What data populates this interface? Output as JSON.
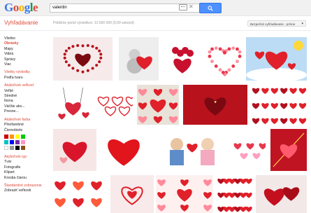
{
  "logo": {
    "text": "Google",
    "letters": [
      [
        "G",
        "#3b78e7"
      ],
      [
        "o",
        "#dd4b39"
      ],
      [
        "o",
        "#f4b400"
      ],
      [
        "g",
        "#3b78e7"
      ],
      [
        "l",
        "#0f9d58"
      ],
      [
        "e",
        "#dd4b39"
      ]
    ]
  },
  "search": {
    "query": "valentin"
  },
  "header": {
    "section_title": "Vyhľadávanie",
    "stats": "Približne počet výsledkov: 31 600 000 (0,09 sekúnd)",
    "safe_search": "Bezpečné vyhľadávanie - prísne"
  },
  "sidebar": {
    "groups": [
      [
        {
          "label": "Všetko",
          "type": "link"
        },
        {
          "label": "Obrázky",
          "type": "active"
        },
        {
          "label": "Mapy",
          "type": "link"
        },
        {
          "label": "Videá",
          "type": "link"
        },
        {
          "label": "Správy",
          "type": "link"
        },
        {
          "label": "Viac",
          "type": "link"
        }
      ],
      [
        {
          "label": "Všetky výsledky",
          "type": "head"
        },
        {
          "label": "Podľa tvaru",
          "type": "link"
        }
      ],
      [
        {
          "label": "Akákoľvek veľkosť",
          "type": "head"
        },
        {
          "label": "Veľké",
          "type": "link"
        },
        {
          "label": "Stredné",
          "type": "link"
        },
        {
          "label": "Ikona",
          "type": "link"
        },
        {
          "label": "Väčšie ako...",
          "type": "link"
        },
        {
          "label": "Presne...",
          "type": "link"
        }
      ],
      [
        {
          "label": "Akákoľvek farba",
          "type": "head"
        },
        {
          "label": "Plnofarebné",
          "type": "link"
        },
        {
          "label": "Čiernobiele",
          "type": "link"
        }
      ],
      [
        {
          "label": "Akýkoľvek typ",
          "type": "head"
        },
        {
          "label": "Tvár",
          "type": "link"
        },
        {
          "label": "Fotografie",
          "type": "link"
        },
        {
          "label": "Klipart",
          "type": "link"
        },
        {
          "label": "Kresba čiarou",
          "type": "link"
        }
      ],
      [
        {
          "label": "Štandardné zobrazenie",
          "type": "head"
        },
        {
          "label": "Zobraziť veľkosti",
          "type": "link"
        }
      ]
    ],
    "swatch_colors": [
      "#cc0000",
      "#fb940b",
      "#ffff00",
      "#00cc00",
      "#03c0c6",
      "#0000ff",
      "#762ca7",
      "#ff98bf",
      "#ffffff",
      "#999999",
      "#000000",
      "#885418"
    ]
  },
  "results": [
    {
      "bg": "#f6eaea",
      "style": "heart-beads",
      "color": "#b5121b"
    },
    {
      "bg": "#eeeeee",
      "style": "bear",
      "color": "#e0202a"
    },
    {
      "bg": "#ffffff",
      "style": "roses",
      "color": "#c8102e"
    },
    {
      "bg": "#ffffff",
      "style": "heart-ring",
      "color": "#e8374a"
    },
    {
      "bg": "#bcdcf5",
      "style": "sky",
      "color": "#e0202a"
    },
    {
      "bg": "#ffffff",
      "style": "swing",
      "color": "#d8263a"
    },
    {
      "bg": "#ffffff",
      "style": "outlines",
      "color": "#e0202a"
    },
    {
      "bg": "#e8e2d8",
      "style": "cluster",
      "color": "#e0202a"
    },
    {
      "bg": "#b8121c",
      "style": "text-card",
      "color": "#f3c6ca"
    },
    {
      "bg": "#ffffff",
      "style": "many",
      "color": "#e0202a"
    },
    {
      "bg": "#f7e6e6",
      "style": "single",
      "color": "#d8152a"
    },
    {
      "bg": "#ffffff",
      "style": "big",
      "color": "#e2151c"
    },
    {
      "bg": "#ffffff",
      "style": "kids",
      "color": "#e0202a"
    },
    {
      "bg": "#ffffff",
      "style": "pink",
      "color": "#e8374a"
    },
    {
      "bg": "#c01422",
      "style": "arrow",
      "color": "#ff5a6e"
    },
    {
      "bg": "#ffffff",
      "style": "row",
      "color": "#e0202a"
    },
    {
      "bg": "#f8eaea",
      "style": "swirl",
      "color": "#e0202a"
    },
    {
      "bg": "#fff0f0",
      "style": "cluster",
      "color": "#e0202a"
    },
    {
      "bg": "#ffffff",
      "style": "many",
      "color": "#e0202a"
    },
    {
      "bg": "#f2e8e8",
      "style": "pair",
      "color": "#c40f1e"
    }
  ]
}
